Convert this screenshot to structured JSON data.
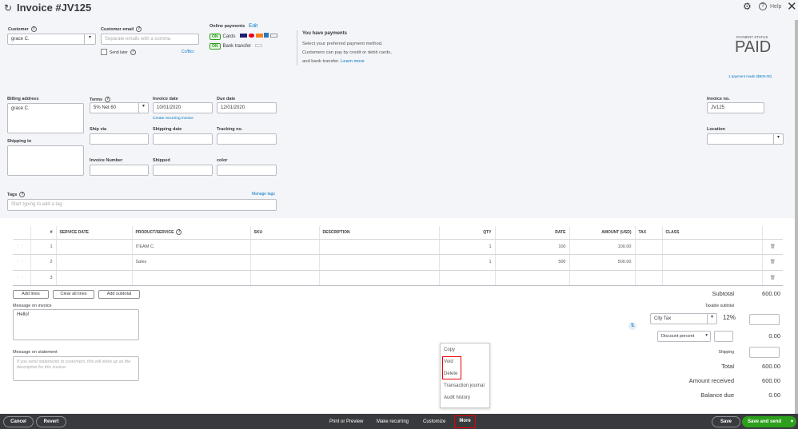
{
  "header": {
    "title": "Invoice #JV125",
    "help": "Help"
  },
  "customer": {
    "label": "Customer",
    "value": "grace C."
  },
  "email": {
    "label": "Customer email",
    "placeholder": "Separate emails with a comma",
    "send_later": "Send later",
    "cc_bcc": "Cc/Bcc"
  },
  "online_payments": {
    "label": "Online payments",
    "edit": "Edit",
    "on": "ON",
    "cards": "Cards",
    "bank": "Bank transfer"
  },
  "payments_info": {
    "title": "You have payments",
    "body": "Select your preferred payment method. Customers can pay by credit or debit cards, and bank transfer.",
    "learn_more": "Learn more"
  },
  "status": {
    "label": "PAYMENT STATUS",
    "value": "PAID",
    "payment_link": "1 payment made ($600.00)"
  },
  "billing": {
    "label": "Billing address",
    "value": "grace C."
  },
  "shipping_to": {
    "label": "Shipping to"
  },
  "terms": {
    "label": "Terms",
    "value": "5% Net 60"
  },
  "invoice_date": {
    "label": "Invoice date",
    "value": "10/01/2020",
    "recurring": "Create recurring invoice"
  },
  "due_date": {
    "label": "Due date",
    "value": "12/01/2020"
  },
  "ship_via": {
    "label": "Ship via"
  },
  "shipping_date": {
    "label": "Shipping date"
  },
  "tracking": {
    "label": "Tracking no."
  },
  "invoice_number": {
    "label": "Invoice Number"
  },
  "shipped": {
    "label": "Shipped"
  },
  "color": {
    "label": "color"
  },
  "invoice_no": {
    "label": "Invoice no.",
    "value": "JV125"
  },
  "location": {
    "label": "Location"
  },
  "tags": {
    "label": "Tags",
    "manage": "Manage tags",
    "placeholder": "Start typing to add a tag"
  },
  "table": {
    "headers": [
      "#",
      "SERVICE DATE",
      "PRODUCT/SERVICE",
      "SKU",
      "DESCRIPTION",
      "QTY",
      "RATE",
      "AMOUNT (USD)",
      "TAX",
      "CLASS"
    ],
    "rows": [
      {
        "n": "1",
        "product": "ITEAM C.",
        "qty": "1",
        "rate": "100",
        "amount": "100.00"
      },
      {
        "n": "2",
        "product": "Sales",
        "qty": "1",
        "rate": "500",
        "amount": "500.00"
      },
      {
        "n": "3",
        "product": "",
        "qty": "",
        "rate": "",
        "amount": ""
      }
    ]
  },
  "line_buttons": {
    "add": "Add lines",
    "clear": "Clear all lines",
    "subtotal": "Add subtotal"
  },
  "message_invoice": {
    "label": "Message on invoice",
    "value": "Hello!"
  },
  "message_statement": {
    "label": "Message on statement",
    "placeholder": "If you send statements to customers, this will show up as the description for this invoice."
  },
  "totals": {
    "subtotal_label": "Subtotal",
    "subtotal": "600.00",
    "taxable": "Taxable subtotal",
    "tax_select": "City Tax",
    "tax_rate": "12%",
    "discount_select": "Discount percent",
    "discount": "0.00",
    "shipping": "Shipping",
    "total_label": "Total",
    "total": "600.00",
    "received_label": "Amount received",
    "received": "600.00",
    "balance_label": "Balance due",
    "balance": "0.00"
  },
  "more_menu": [
    "Copy",
    "Void",
    "Delete",
    "Transaction journal",
    "Audit history"
  ],
  "footer": {
    "cancel": "Cancel",
    "revert": "Revert",
    "print": "Print or Preview",
    "recurring": "Make recurring",
    "customize": "Customize",
    "more": "More",
    "save": "Save",
    "save_send": "Save and send"
  }
}
